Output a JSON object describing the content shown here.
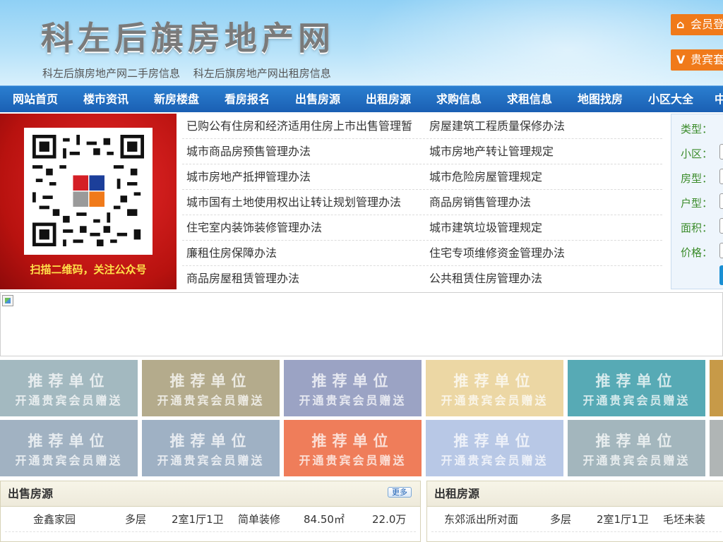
{
  "header": {
    "site_title": "科左后旗房地产网",
    "sub_links": [
      "科左后旗房地产网二手房信息",
      "科左后旗房地产网出租房信息"
    ],
    "login_label": "会员登",
    "login_icon": "home-icon",
    "vip_label": "贵宾套",
    "vip_icon": "vip-icon"
  },
  "nav": [
    "网站首页",
    "楼市资讯",
    "新房楼盘",
    "看房报名",
    "出售房源",
    "出租房源",
    "求购信息",
    "求租信息",
    "地图找房",
    "小区大全",
    "中"
  ],
  "qr": {
    "caption": "扫描二维码，关注公众号"
  },
  "policies": [
    [
      "已购公有住房和经济适用住房上市出售管理暂",
      "房屋建筑工程质量保修办法"
    ],
    [
      "城市商品房预售管理办法",
      "城市房地产转让管理规定"
    ],
    [
      "城市房地产抵押管理办法",
      "城市危险房屋管理规定"
    ],
    [
      "城市国有土地使用权出让转让规划管理办法",
      "商品房销售管理办法"
    ],
    [
      "住宅室内装饰装修管理办法",
      "城市建筑垃圾管理规定"
    ],
    [
      "廉租住房保障办法",
      "住宅专项维修资金管理办法"
    ],
    [
      "商品房屋租赁管理办法",
      "公共租赁住房管理办法"
    ]
  ],
  "search": {
    "labels": [
      "类型：",
      "小区：",
      "房型：",
      "户型：",
      "面积：",
      "价格："
    ]
  },
  "recommend": {
    "line1": "推荐单位",
    "line2": "开通贵宾会员赠送",
    "colors": [
      "#a3b9c0",
      "#b4ab8c",
      "#9ba3c4",
      "#ecd7a4",
      "#57aab5",
      "#c79a48",
      "#a1b2c2",
      "#9fb1c4",
      "#ef7d5a",
      "#b8c8e6",
      "#a3b6bd",
      "#b0b5b5"
    ]
  },
  "sale": {
    "title": "出售房源",
    "more": "更多",
    "rows": [
      [
        "金鑫家园",
        "多层",
        "2室1厅1卫",
        "简单装修",
        "84.50㎡",
        "22.0万"
      ]
    ]
  },
  "rent": {
    "title": "出租房源",
    "rows": [
      [
        "东郊派出所对面",
        "多层",
        "2室1厅1卫",
        "毛坯未装"
      ]
    ]
  }
}
